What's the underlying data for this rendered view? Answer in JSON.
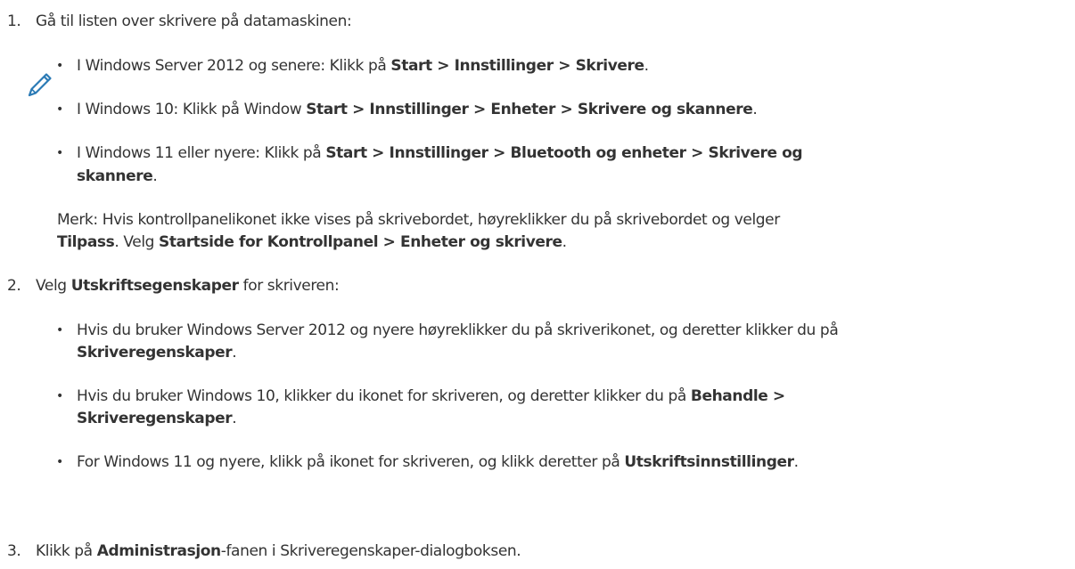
{
  "doc": {
    "step1": {
      "number": "1.",
      "text": "Gå til listen over skrivere på datamaskinen:",
      "bullets": [
        {
          "pre": "I Windows Server 2012 og senere: Klikk på ",
          "bold": "Start > Innstillinger > Skrivere",
          "post": "."
        },
        {
          "pre": "I Windows 10: Klikk på Window ",
          "bold": "Start > Innstillinger > Enheter > Skrivere og skannere",
          "post": "."
        },
        {
          "pre": "I Windows 11 eller nyere: Klikk på ",
          "bold": "Start > Innstillinger > Bluetooth og enheter > Skrivere og",
          "cont_bold": "skannere",
          "cont_post": "."
        }
      ]
    },
    "note": {
      "line1": "Merk: Hvis kontrollpanelikonet ikke vises på skrivebordet, høyreklikker du på skrivebordet og velger",
      "l2_b1": "Tilpass",
      "l2_t1": ". Velg ",
      "l2_b2": "Startside for Kontrollpanel > Enheter og skrivere",
      "l2_t2": "."
    },
    "step2": {
      "number": "2.",
      "pre": "Velg ",
      "bold": "Utskriftsegenskaper",
      "post": " for skriveren:",
      "bullets": [
        {
          "line1": "Hvis du bruker Windows Server 2012 og nyere høyreklikker du på skriverikonet, og deretter klikker du på",
          "cont_bold": "Skriveregenskaper",
          "cont_post": "."
        },
        {
          "line1": "Hvis du bruker Windows 10, klikker du ikonet for skriveren, og deretter klikker du på ",
          "line1_bold": "Behandle >",
          "cont_bold": "Skriveregenskaper",
          "cont_post": "."
        },
        {
          "pre": "For Windows 11 og nyere, klikk på ikonet for skriveren, og klikk deretter på ",
          "bold": "Utskriftsinnstillinger",
          "post": "."
        }
      ]
    },
    "step3": {
      "number": "3.",
      "pre": "Klikk på ",
      "bold": "Administrasjon",
      "post": "-fanen i Skriveregenskaper-dialogboksen."
    },
    "bullet_char": "•",
    "colors": {
      "text": "#333333",
      "icon": "#2a7ab5"
    }
  }
}
